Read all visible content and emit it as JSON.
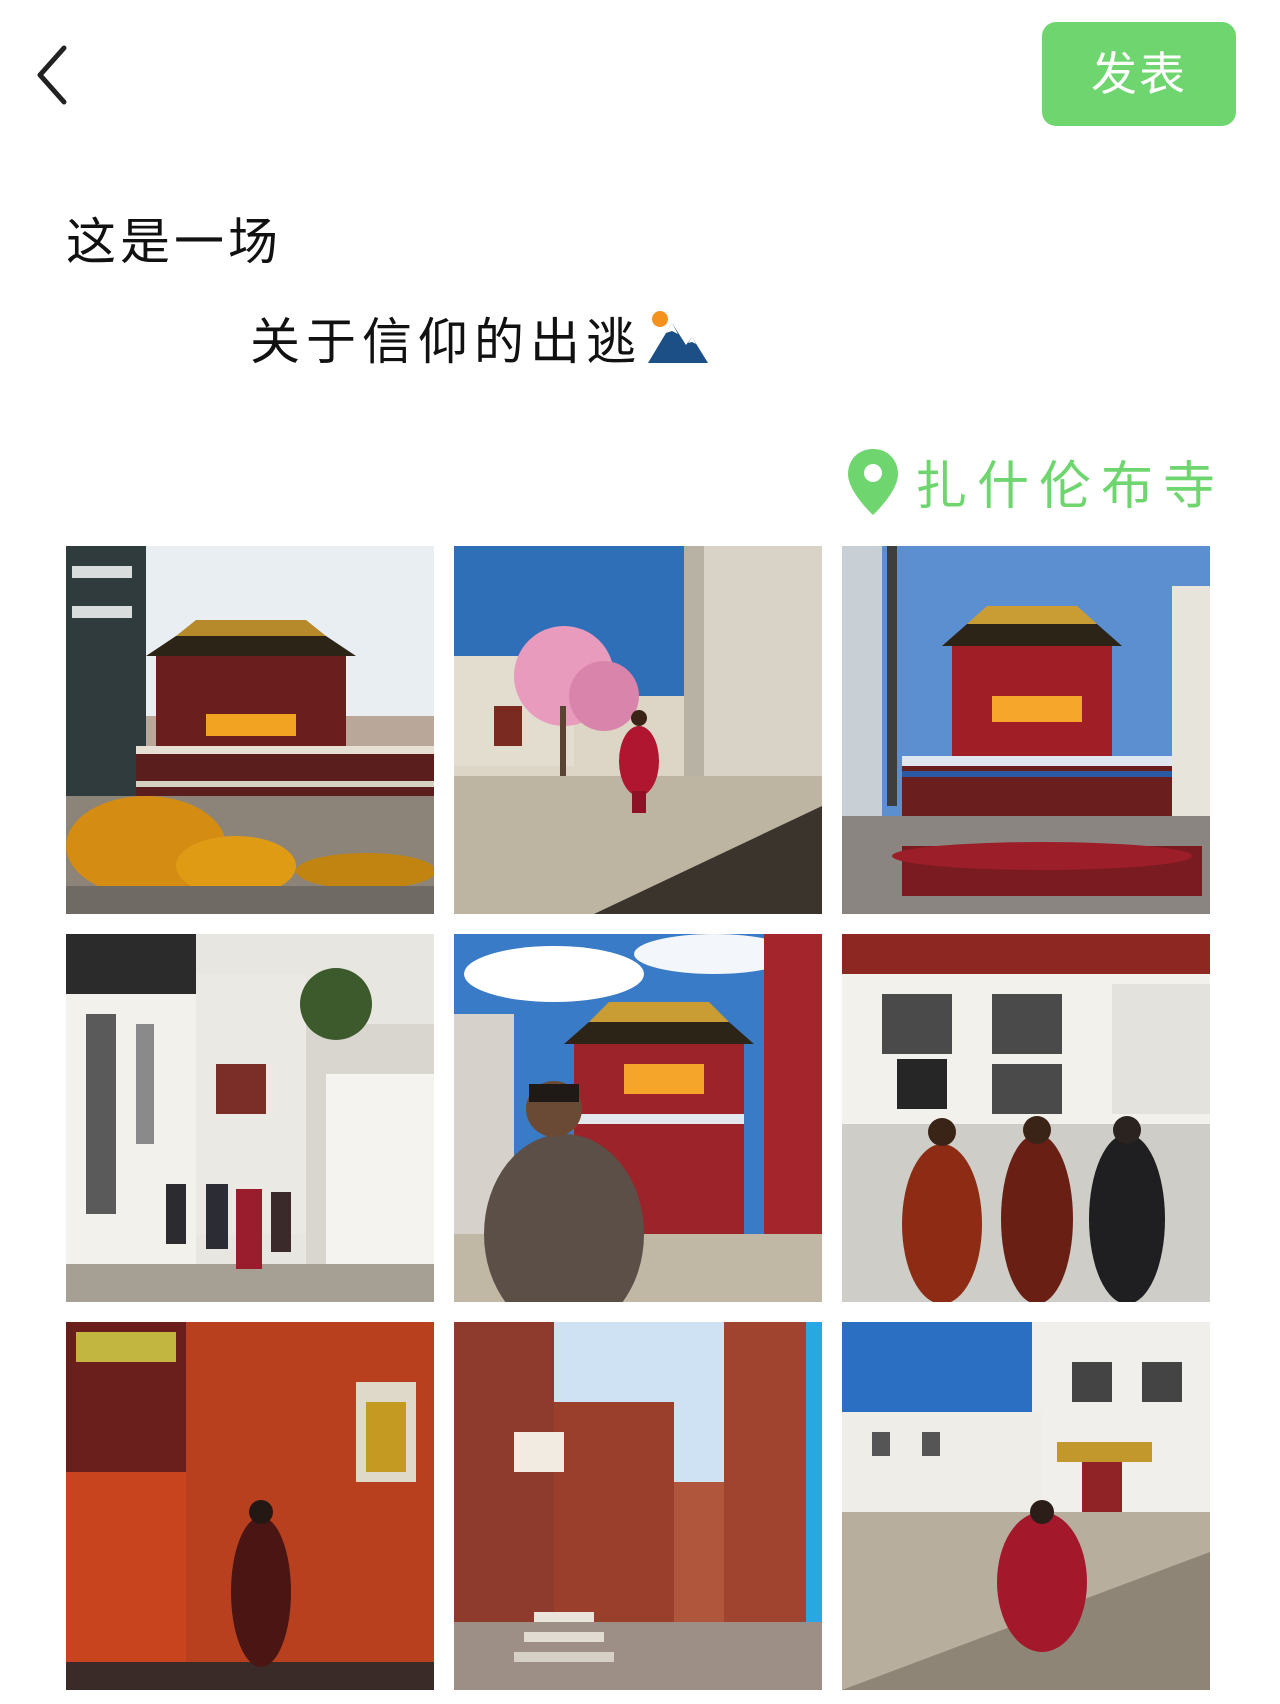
{
  "header": {
    "back_icon": "chevron-left-icon",
    "publish_label": "发表",
    "publish_color": "#6fd66f"
  },
  "post": {
    "line1": "这是一场",
    "line2": "关于信仰的出逃",
    "emoji_icon": "mountain-sun-icon"
  },
  "location": {
    "icon": "location-pin-icon",
    "name": "扎什伦布寺",
    "color": "#6fd66f"
  },
  "photos": [
    {
      "label": "photo-1"
    },
    {
      "label": "photo-2"
    },
    {
      "label": "photo-3"
    },
    {
      "label": "photo-4"
    },
    {
      "label": "photo-5"
    },
    {
      "label": "photo-6"
    },
    {
      "label": "photo-7"
    },
    {
      "label": "photo-8"
    },
    {
      "label": "photo-9"
    }
  ]
}
